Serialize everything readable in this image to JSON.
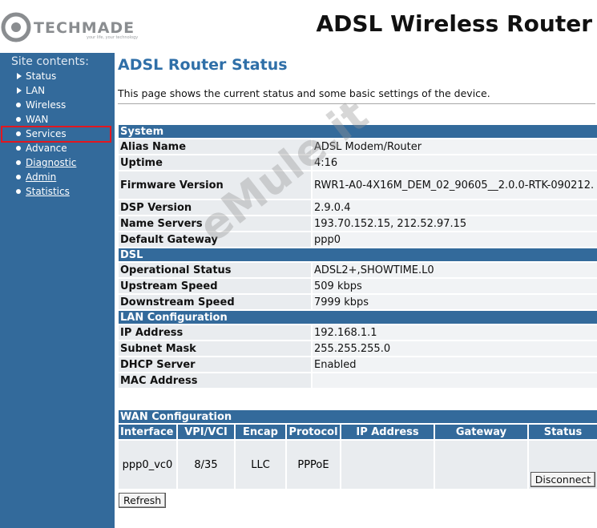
{
  "brand": {
    "logo_name": "TECHMADE",
    "tagline": "your life, your technology",
    "banner_title": "ADSL Wireless Router"
  },
  "sidebar": {
    "heading": "Site contents:",
    "items": [
      {
        "label": "Status",
        "bullet": "triangle"
      },
      {
        "label": "LAN",
        "bullet": "triangle"
      },
      {
        "label": "Wireless",
        "bullet": "dot"
      },
      {
        "label": "WAN",
        "bullet": "dot"
      },
      {
        "label": "Services",
        "bullet": "dot",
        "highlighted": true
      },
      {
        "label": "Advance",
        "bullet": "dot"
      },
      {
        "label": "Diagnostic",
        "bullet": "dot"
      },
      {
        "label": "Admin",
        "bullet": "dot"
      },
      {
        "label": "Statistics",
        "bullet": "dot"
      }
    ]
  },
  "main": {
    "title": "ADSL Router Status",
    "description": "This page shows the current status and some basic settings of the device.",
    "system": {
      "heading": "System",
      "rows": [
        {
          "key": "Alias Name",
          "value": "ADSL Modem/Router"
        },
        {
          "key": "Uptime",
          "value": "4:16"
        },
        {
          "key": "Firmware Version",
          "value": "RWR1-A0-4X16M_DEM_02_90605__2.0.0-RTK-090212."
        },
        {
          "key": "DSP Version",
          "value": "2.9.0.4"
        },
        {
          "key": "Name Servers",
          "value": "193.70.152.15, 212.52.97.15"
        },
        {
          "key": "Default Gateway",
          "value": "ppp0"
        }
      ]
    },
    "dsl": {
      "heading": "DSL",
      "rows": [
        {
          "key": "Operational Status",
          "value": "ADSL2+,SHOWTIME.L0"
        },
        {
          "key": "Upstream Speed",
          "value": "509 kbps"
        },
        {
          "key": "Downstream Speed",
          "value": "7999 kbps"
        }
      ]
    },
    "lan": {
      "heading": "LAN Configuration",
      "rows": [
        {
          "key": "IP Address",
          "value": "192.168.1.1"
        },
        {
          "key": "Subnet Mask",
          "value": "255.255.255.0"
        },
        {
          "key": "DHCP Server",
          "value": "Enabled"
        },
        {
          "key": "MAC Address",
          "value": ""
        }
      ]
    },
    "wan": {
      "heading": "WAN Configuration",
      "columns": [
        "Interface",
        "VPI/VCI",
        "Encap",
        "Protocol",
        "IP Address",
        "Gateway",
        "Status"
      ],
      "row": {
        "interface": "ppp0_vc0",
        "vpi_vci": "8/35",
        "encap": "LLC",
        "protocol": "PPPoE",
        "ip_address": "",
        "gateway": "",
        "status_button": "Disconnect"
      }
    },
    "refresh_label": "Refresh"
  },
  "watermark": "eMule.it",
  "colors": {
    "sidebar_bg": "#336a9b",
    "section_header": "#336a9b",
    "title_blue": "#2f6fa8",
    "highlight_red": "#e2171f"
  }
}
